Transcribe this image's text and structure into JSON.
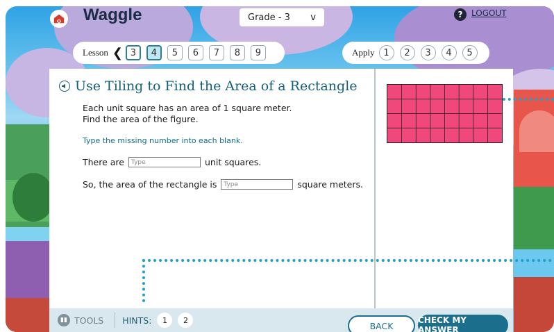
{
  "app": {
    "logo": "Waggle"
  },
  "header": {
    "grade_selected": "Grade - 3",
    "grade_chevron": "v",
    "help_symbol": "?",
    "logout": "LOGOUT"
  },
  "lesson_nav": {
    "label": "Lesson",
    "chevron": "❮",
    "items": [
      "3",
      "4",
      "5",
      "6",
      "7",
      "8",
      "9"
    ],
    "active_item": "4"
  },
  "apply_nav": {
    "label": "Apply",
    "items": [
      "1",
      "2",
      "3",
      "4",
      "5"
    ]
  },
  "question": {
    "title": "Use Tiling to Find the Area of a Rectangle",
    "line1": "Each unit square has an area of 1 square meter.",
    "line2": "Find the area of the figure.",
    "instruction": "Type the missing number into each blank.",
    "row1_before": "There are",
    "row1_after": "unit squares.",
    "row2_before": "So, the area of the rectangle is",
    "row2_after": "square meters.",
    "input_placeholder": "Type"
  },
  "figure": {
    "rows": 4,
    "cols": 8,
    "fill_color": "#f0487a",
    "line_color": "#222222"
  },
  "bottom_bar": {
    "tools": "TOOLS",
    "hints_label": "HINTS:",
    "hints": [
      "1",
      "2"
    ],
    "back": "BACK",
    "check": "CHECK MY ANSWER"
  },
  "colors": {
    "accent": "#1b6f8d",
    "title": "#14607a",
    "dotted": "#1ea1c7"
  }
}
